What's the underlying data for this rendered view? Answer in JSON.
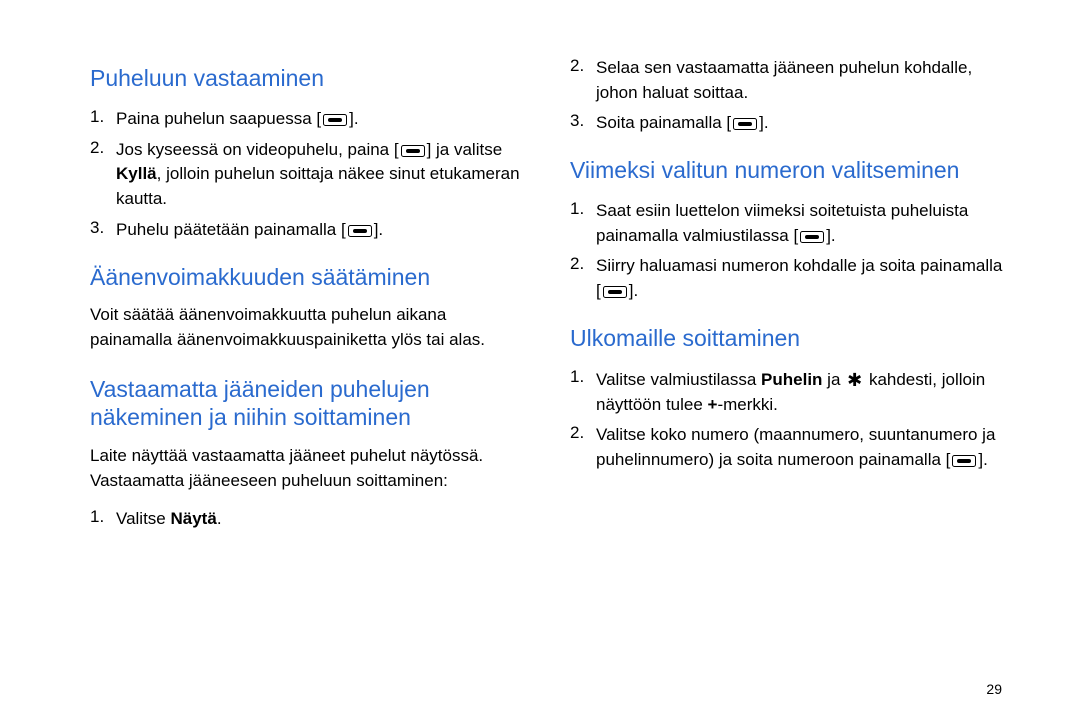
{
  "page_number": "29",
  "left": {
    "sec1": {
      "heading": "Puheluun vastaaminen",
      "items": [
        {
          "num": "1.",
          "parts": [
            "Paina puhelun saapuessa [",
            "KEY",
            "]."
          ]
        },
        {
          "num": "2.",
          "parts": [
            "Jos kyseessä on videopuhelu, paina [",
            "KEY",
            "] ja valitse ",
            {
              "bold": "Kyllä"
            },
            ", jolloin puhelun soittaja näkee sinut etukameran kautta."
          ]
        },
        {
          "num": "3.",
          "parts": [
            "Puhelu päätetään painamalla [",
            "KEY",
            "]."
          ]
        }
      ]
    },
    "sec2": {
      "heading": "Äänenvoimakkuuden säätäminen",
      "body": "Voit säätää äänenvoimakkuutta puhelun aikana painamalla äänenvoimakkuuspainiketta ylös tai alas."
    },
    "sec3": {
      "heading": "Vastaamatta jääneiden puhelujen näkeminen ja niihin soittaminen",
      "body": "Laite näyttää vastaamatta jääneet puhelut näytössä. Vastaamatta jääneeseen puheluun soittaminen:",
      "items": [
        {
          "num": "1.",
          "parts": [
            "Valitse ",
            {
              "bold": "Näytä"
            },
            "."
          ]
        }
      ]
    }
  },
  "right": {
    "cont_items": [
      {
        "num": "2.",
        "parts": [
          "Selaa sen vastaamatta jääneen puhelun kohdalle, johon haluat soittaa."
        ]
      },
      {
        "num": "3.",
        "parts": [
          "Soita painamalla [",
          "KEY",
          "]."
        ]
      }
    ],
    "sec4": {
      "heading": "Viimeksi valitun numeron valitseminen",
      "items": [
        {
          "num": "1.",
          "parts": [
            "Saat esiin luettelon viimeksi soitetuista puheluista painamalla valmiustilassa [",
            "KEY",
            "]."
          ]
        },
        {
          "num": "2.",
          "parts": [
            "Siirry haluamasi numeron kohdalle ja soita painamalla [",
            "KEY",
            "]."
          ]
        }
      ]
    },
    "sec5": {
      "heading": "Ulkomaille soittaminen",
      "items": [
        {
          "num": "1.",
          "parts": [
            "Valitse valmiustilassa ",
            {
              "bold": "Puhelin"
            },
            " ja ",
            "STAR",
            " kahdesti, jolloin näyttöön tulee ",
            {
              "bold": "+"
            },
            "-merkki."
          ]
        },
        {
          "num": "2.",
          "parts": [
            "Valitse koko numero (maannumero, suuntanumero ja puhelinnumero) ja soita numeroon painamalla [",
            "KEY",
            "]."
          ]
        }
      ]
    }
  }
}
